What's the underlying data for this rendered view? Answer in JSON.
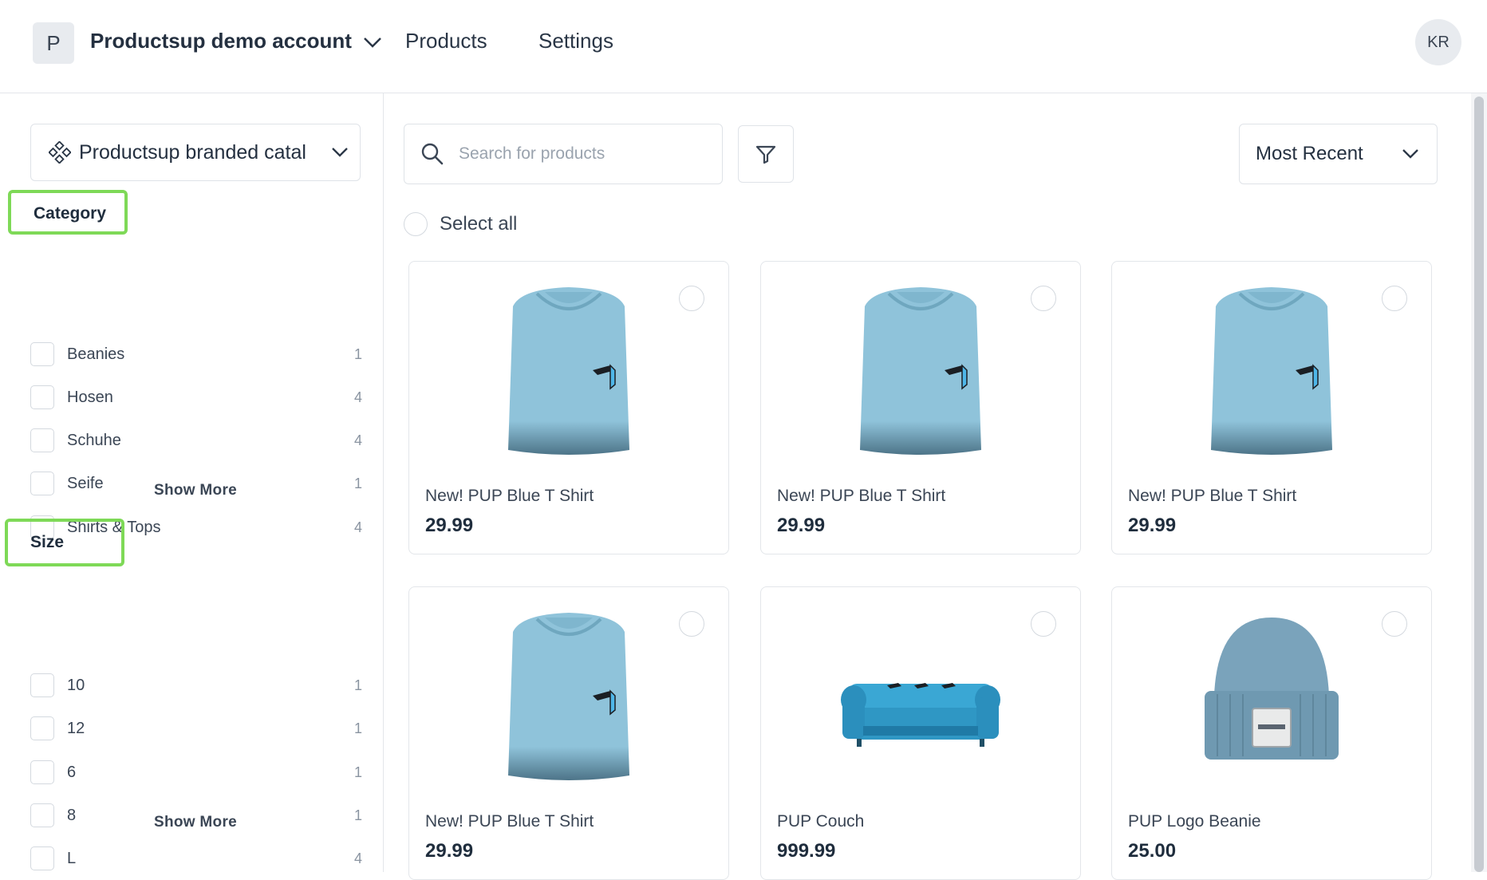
{
  "header": {
    "account_initial": "P",
    "account_name": "Productsup demo account",
    "nav": [
      "Products",
      "Settings"
    ],
    "user_initials": "KR"
  },
  "sidebar": {
    "catalog_label": "Productsup branded catal",
    "groups": [
      {
        "title": "Category",
        "items": [
          {
            "label": "Beanies",
            "count": "1"
          },
          {
            "label": "Hosen",
            "count": "4"
          },
          {
            "label": "Schuhe",
            "count": "4"
          },
          {
            "label": "Seife",
            "count": "1"
          },
          {
            "label": "Shirts & Tops",
            "count": "4"
          }
        ],
        "show_more": "Show More"
      },
      {
        "title": "Size",
        "items": [
          {
            "label": "10",
            "count": "1"
          },
          {
            "label": "12",
            "count": "1"
          },
          {
            "label": "6",
            "count": "1"
          },
          {
            "label": "8",
            "count": "1"
          },
          {
            "label": "L",
            "count": "4"
          }
        ],
        "show_more": "Show More"
      }
    ]
  },
  "main": {
    "search_placeholder": "Search for products",
    "sort_label": "Most Recent",
    "select_all_label": "Select all",
    "products": [
      {
        "name": "New! PUP Blue T Shirt",
        "price": "29.99",
        "image": "tshirt"
      },
      {
        "name": "New! PUP Blue T Shirt",
        "price": "29.99",
        "image": "tshirt"
      },
      {
        "name": "New! PUP Blue T Shirt",
        "price": "29.99",
        "image": "tshirt"
      },
      {
        "name": "New! PUP Blue T Shirt",
        "price": "29.99",
        "image": "tshirt"
      },
      {
        "name": "PUP Couch",
        "price": "999.99",
        "image": "couch"
      },
      {
        "name": "PUP Logo Beanie",
        "price": "25.00",
        "image": "beanie"
      }
    ]
  },
  "colors": {
    "highlight": "#7ed957",
    "product_blue": "#8fc3da"
  }
}
